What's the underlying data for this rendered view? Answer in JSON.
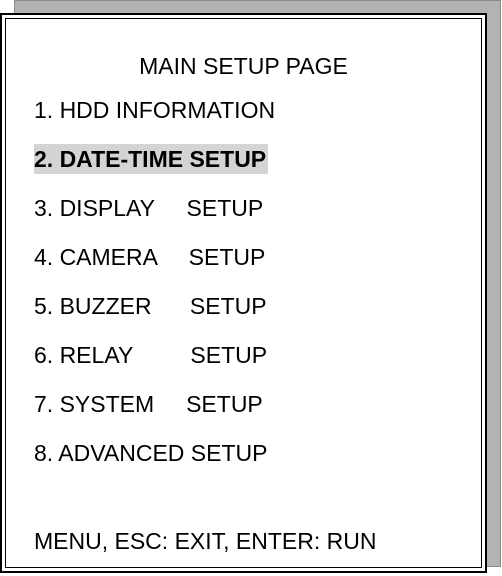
{
  "menu": {
    "title": "MAIN SETUP PAGE",
    "items": [
      {
        "label": "1. HDD INFORMATION"
      },
      {
        "label": "2. DATE-TIME SETUP",
        "selected": true
      },
      {
        "label": "3. DISPLAY     SETUP"
      },
      {
        "label": "4. CAMERA     SETUP"
      },
      {
        "label": "5. BUZZER      SETUP"
      },
      {
        "label": "6. RELAY         SETUP"
      },
      {
        "label": "7. SYSTEM     SETUP"
      },
      {
        "label": "8. ADVANCED SETUP"
      }
    ],
    "footer": "MENU, ESC: EXIT, ENTER: RUN"
  },
  "colors": {
    "highlight": "#d4d4d4",
    "shadow": "#b3b3b3",
    "text": "#000000",
    "border": "#000000"
  }
}
